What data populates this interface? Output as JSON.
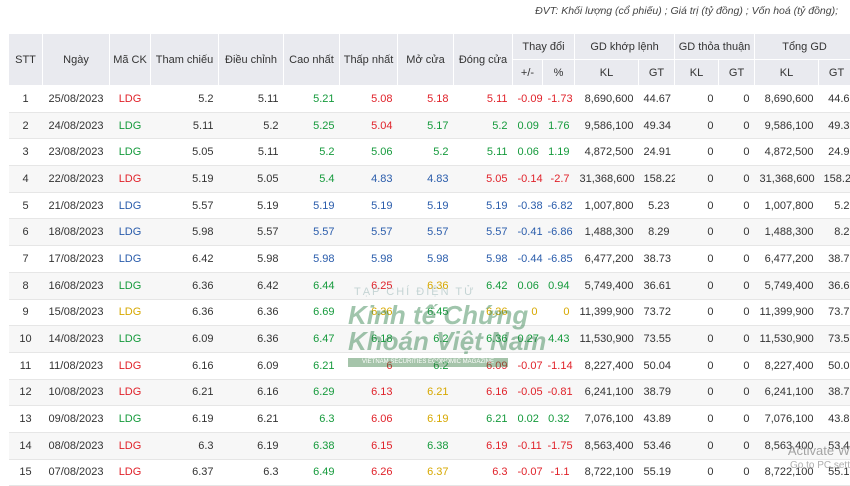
{
  "unit_note": "ĐVT: Khối lượng (cổ phiếu) ; Giá trị (tỷ đồng) ; Vốn hoá (tỷ đồng);",
  "headers": {
    "stt": "STT",
    "ngay": "Ngày",
    "ma_ck": "Mã CK",
    "tham_chieu": "Tham chiếu",
    "dieu_chinh": "Điều chỉnh",
    "cao_nhat": "Cao nhất",
    "thap_nhat": "Thấp nhất",
    "mo_cua": "Mở cửa",
    "dong_cua": "Đóng cửa",
    "thay_doi": "Thay đổi",
    "gd_khop_lenh": "GD khớp lệnh",
    "gd_thoa_thuan": "GD thỏa thuận",
    "tong_gd": "Tổng GD",
    "plus_minus": "+/-",
    "pct": "%",
    "kl": "KL",
    "gt": "GT"
  },
  "rows": [
    {
      "stt": "1",
      "ngay": "25/08/2023",
      "ma": "LDG",
      "ma_c": "down",
      "tc": "5.2",
      "dc": "5.11",
      "cao": "5.21",
      "cao_c": "up",
      "thap": "5.08",
      "thap_c": "down",
      "mo": "5.18",
      "mo_c": "down",
      "dong": "5.11",
      "dong_c": "down",
      "pm": "-0.09",
      "pct": "-1.73",
      "chg_c": "down",
      "kl1": "8,690,600",
      "gt1": "44.67",
      "kl2": "0",
      "gt2": "0",
      "kl3": "8,690,600",
      "gt3": "44.6"
    },
    {
      "stt": "2",
      "ngay": "24/08/2023",
      "ma": "LDG",
      "ma_c": "up",
      "tc": "5.11",
      "dc": "5.2",
      "cao": "5.25",
      "cao_c": "up",
      "thap": "5.04",
      "thap_c": "down",
      "mo": "5.17",
      "mo_c": "up",
      "dong": "5.2",
      "dong_c": "up",
      "pm": "0.09",
      "pct": "1.76",
      "chg_c": "up",
      "kl1": "9,586,100",
      "gt1": "49.34",
      "kl2": "0",
      "gt2": "0",
      "kl3": "9,586,100",
      "gt3": "49.3"
    },
    {
      "stt": "3",
      "ngay": "23/08/2023",
      "ma": "LDG",
      "ma_c": "up",
      "tc": "5.05",
      "dc": "5.11",
      "cao": "5.2",
      "cao_c": "up",
      "thap": "5.06",
      "thap_c": "up",
      "mo": "5.2",
      "mo_c": "up",
      "dong": "5.11",
      "dong_c": "up",
      "pm": "0.06",
      "pct": "1.19",
      "chg_c": "up",
      "kl1": "4,872,500",
      "gt1": "24.91",
      "kl2": "0",
      "gt2": "0",
      "kl3": "4,872,500",
      "gt3": "24.9"
    },
    {
      "stt": "4",
      "ngay": "22/08/2023",
      "ma": "LDG",
      "ma_c": "down",
      "tc": "5.19",
      "dc": "5.05",
      "cao": "5.4",
      "cao_c": "up",
      "thap": "4.83",
      "thap_c": "floor",
      "mo": "4.83",
      "mo_c": "floor",
      "dong": "5.05",
      "dong_c": "down",
      "pm": "-0.14",
      "pct": "-2.7",
      "chg_c": "down",
      "kl1": "31,368,600",
      "gt1": "158.22",
      "kl2": "0",
      "gt2": "0",
      "kl3": "31,368,600",
      "gt3": "158.2"
    },
    {
      "stt": "5",
      "ngay": "21/08/2023",
      "ma": "LDG",
      "ma_c": "floor",
      "tc": "5.57",
      "dc": "5.19",
      "cao": "5.19",
      "cao_c": "floor",
      "thap": "5.19",
      "thap_c": "floor",
      "mo": "5.19",
      "mo_c": "floor",
      "dong": "5.19",
      "dong_c": "floor",
      "pm": "-0.38",
      "pct": "-6.82",
      "chg_c": "floor",
      "kl1": "1,007,800",
      "gt1": "5.23",
      "kl2": "0",
      "gt2": "0",
      "kl3": "1,007,800",
      "gt3": "5.2"
    },
    {
      "stt": "6",
      "ngay": "18/08/2023",
      "ma": "LDG",
      "ma_c": "floor",
      "tc": "5.98",
      "dc": "5.57",
      "cao": "5.57",
      "cao_c": "floor",
      "thap": "5.57",
      "thap_c": "floor",
      "mo": "5.57",
      "mo_c": "floor",
      "dong": "5.57",
      "dong_c": "floor",
      "pm": "-0.41",
      "pct": "-6.86",
      "chg_c": "floor",
      "kl1": "1,488,300",
      "gt1": "8.29",
      "kl2": "0",
      "gt2": "0",
      "kl3": "1,488,300",
      "gt3": "8.2"
    },
    {
      "stt": "7",
      "ngay": "17/08/2023",
      "ma": "LDG",
      "ma_c": "floor",
      "tc": "6.42",
      "dc": "5.98",
      "cao": "5.98",
      "cao_c": "floor",
      "thap": "5.98",
      "thap_c": "floor",
      "mo": "5.98",
      "mo_c": "floor",
      "dong": "5.98",
      "dong_c": "floor",
      "pm": "-0.44",
      "pct": "-6.85",
      "chg_c": "floor",
      "kl1": "6,477,200",
      "gt1": "38.73",
      "kl2": "0",
      "gt2": "0",
      "kl3": "6,477,200",
      "gt3": "38.7"
    },
    {
      "stt": "8",
      "ngay": "16/08/2023",
      "ma": "LDG",
      "ma_c": "up",
      "tc": "6.36",
      "dc": "6.42",
      "cao": "6.44",
      "cao_c": "up",
      "thap": "6.25",
      "thap_c": "down",
      "mo": "6.36",
      "mo_c": "ref",
      "dong": "6.42",
      "dong_c": "up",
      "pm": "0.06",
      "pct": "0.94",
      "chg_c": "up",
      "kl1": "5,749,400",
      "gt1": "36.61",
      "kl2": "0",
      "gt2": "0",
      "kl3": "5,749,400",
      "gt3": "36.6"
    },
    {
      "stt": "9",
      "ngay": "15/08/2023",
      "ma": "LDG",
      "ma_c": "ref",
      "tc": "6.36",
      "dc": "6.36",
      "cao": "6.69",
      "cao_c": "up",
      "thap": "6.36",
      "thap_c": "ref",
      "mo": "6.45",
      "mo_c": "up",
      "dong": "6.36",
      "dong_c": "ref",
      "pm": "0",
      "pct": "0",
      "chg_c": "ref",
      "kl1": "11,399,900",
      "gt1": "73.72",
      "kl2": "0",
      "gt2": "0",
      "kl3": "11,399,900",
      "gt3": "73.7"
    },
    {
      "stt": "10",
      "ngay": "14/08/2023",
      "ma": "LDG",
      "ma_c": "up",
      "tc": "6.09",
      "dc": "6.36",
      "cao": "6.47",
      "cao_c": "up",
      "thap": "6.18",
      "thap_c": "up",
      "mo": "6.2",
      "mo_c": "up",
      "dong": "6.36",
      "dong_c": "up",
      "pm": "0.27",
      "pct": "4.43",
      "chg_c": "up",
      "kl1": "11,530,900",
      "gt1": "73.55",
      "kl2": "0",
      "gt2": "0",
      "kl3": "11,530,900",
      "gt3": "73.5"
    },
    {
      "stt": "11",
      "ngay": "11/08/2023",
      "ma": "LDG",
      "ma_c": "down",
      "tc": "6.16",
      "dc": "6.09",
      "cao": "6.21",
      "cao_c": "up",
      "thap": "6",
      "thap_c": "down",
      "mo": "6.2",
      "mo_c": "up",
      "dong": "6.09",
      "dong_c": "down",
      "pm": "-0.07",
      "pct": "-1.14",
      "chg_c": "down",
      "kl1": "8,227,400",
      "gt1": "50.04",
      "kl2": "0",
      "gt2": "0",
      "kl3": "8,227,400",
      "gt3": "50.0"
    },
    {
      "stt": "12",
      "ngay": "10/08/2023",
      "ma": "LDG",
      "ma_c": "down",
      "tc": "6.21",
      "dc": "6.16",
      "cao": "6.29",
      "cao_c": "up",
      "thap": "6.13",
      "thap_c": "down",
      "mo": "6.21",
      "mo_c": "ref",
      "dong": "6.16",
      "dong_c": "down",
      "pm": "-0.05",
      "pct": "-0.81",
      "chg_c": "down",
      "kl1": "6,241,100",
      "gt1": "38.79",
      "kl2": "0",
      "gt2": "0",
      "kl3": "6,241,100",
      "gt3": "38.7"
    },
    {
      "stt": "13",
      "ngay": "09/08/2023",
      "ma": "LDG",
      "ma_c": "up",
      "tc": "6.19",
      "dc": "6.21",
      "cao": "6.3",
      "cao_c": "up",
      "thap": "6.06",
      "thap_c": "down",
      "mo": "6.19",
      "mo_c": "ref",
      "dong": "6.21",
      "dong_c": "up",
      "pm": "0.02",
      "pct": "0.32",
      "chg_c": "up",
      "kl1": "7,076,100",
      "gt1": "43.89",
      "kl2": "0",
      "gt2": "0",
      "kl3": "7,076,100",
      "gt3": "43.8"
    },
    {
      "stt": "14",
      "ngay": "08/08/2023",
      "ma": "LDG",
      "ma_c": "down",
      "tc": "6.3",
      "dc": "6.19",
      "cao": "6.38",
      "cao_c": "up",
      "thap": "6.15",
      "thap_c": "down",
      "mo": "6.38",
      "mo_c": "up",
      "dong": "6.19",
      "dong_c": "down",
      "pm": "-0.11",
      "pct": "-1.75",
      "chg_c": "down",
      "kl1": "8,563,400",
      "gt1": "53.46",
      "kl2": "0",
      "gt2": "0",
      "kl3": "8,563,400",
      "gt3": "53.4"
    },
    {
      "stt": "15",
      "ngay": "07/08/2023",
      "ma": "LDG",
      "ma_c": "down",
      "tc": "6.37",
      "dc": "6.3",
      "cao": "6.49",
      "cao_c": "up",
      "thap": "6.26",
      "thap_c": "down",
      "mo": "6.37",
      "mo_c": "ref",
      "dong": "6.3",
      "dong_c": "down",
      "pm": "-0.07",
      "pct": "-1.1",
      "chg_c": "down",
      "kl1": "8,722,100",
      "gt1": "55.19",
      "kl2": "0",
      "gt2": "0",
      "kl3": "8,722,100",
      "gt3": "55.1"
    }
  ],
  "colors": {
    "up": "#159a3c",
    "down": "#e0222a",
    "ref": "#d7a800",
    "floor": "#2a5cab",
    "header_bg": "#e9eaef"
  },
  "watermark": {
    "top": "TẠP CHÍ ĐIỆN TỬ",
    "line1": "Kinh tế Chứng",
    "line2": "Khoán Việt Nam",
    "bar": "VIETNAM SECURITIES ECONOMIC MAGAZINE"
  },
  "os_overlay": {
    "title": "Activate W",
    "subtitle": "Go to PC sett"
  }
}
